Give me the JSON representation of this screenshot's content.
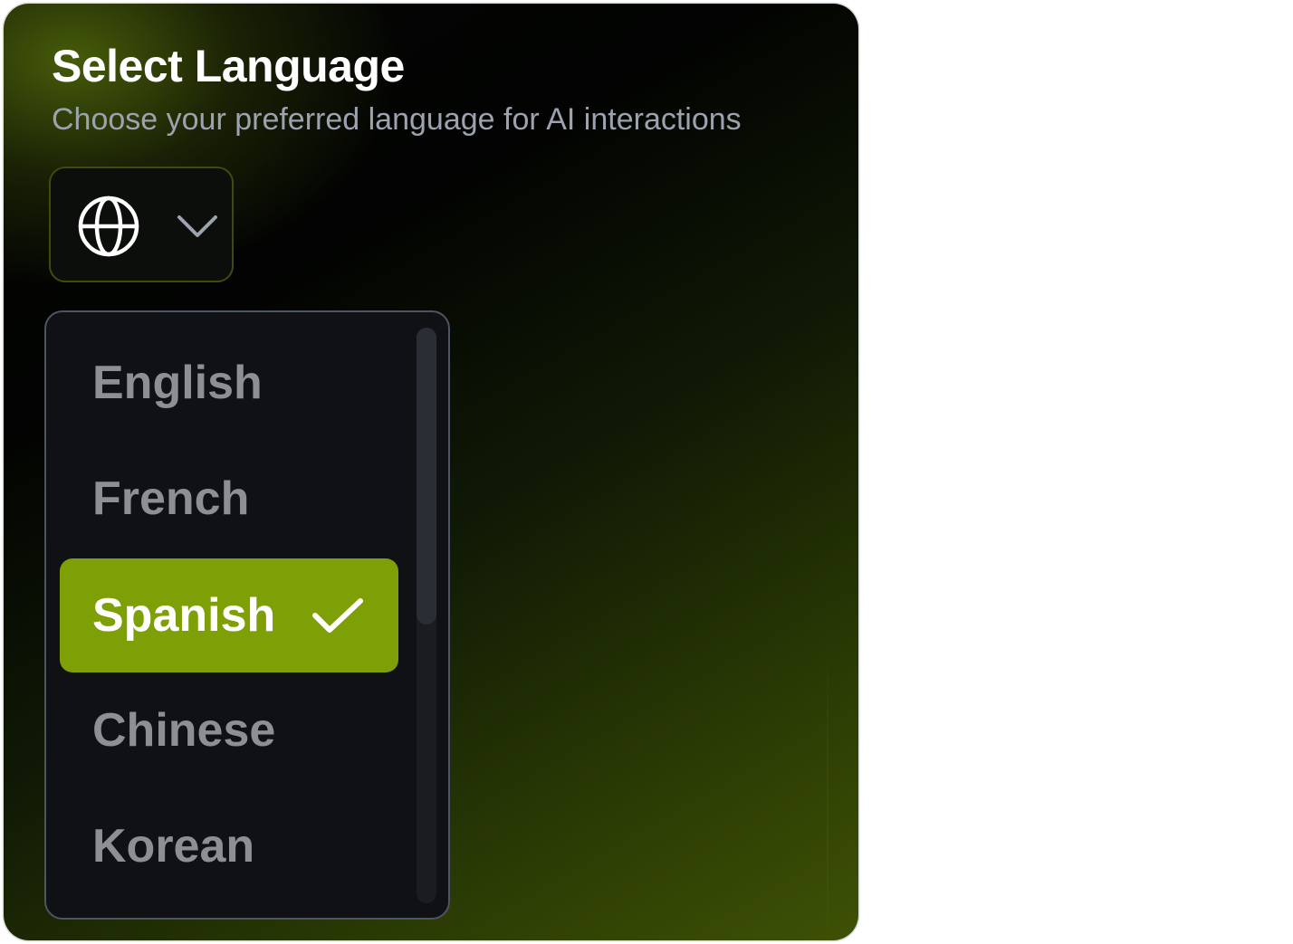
{
  "header": {
    "title": "Select Language",
    "subtitle": "Choose your preferred language for AI interactions"
  },
  "selector": {
    "icon": "globe-icon",
    "chevron_icon": "chevron-down-icon",
    "expanded": true
  },
  "dropdown": {
    "options": [
      {
        "label": "English",
        "selected": false
      },
      {
        "label": "French",
        "selected": false
      },
      {
        "label": "Spanish",
        "selected": true
      },
      {
        "label": "Chinese",
        "selected": false
      },
      {
        "label": "Korean",
        "selected": false
      }
    ],
    "scroll_fraction_visible": 0.52
  },
  "colors": {
    "accent": "#7f9f06",
    "card_background": "#050604",
    "dropdown_background": "#101114",
    "muted_text": "#9ca3af",
    "option_text": "#8c8f93"
  }
}
